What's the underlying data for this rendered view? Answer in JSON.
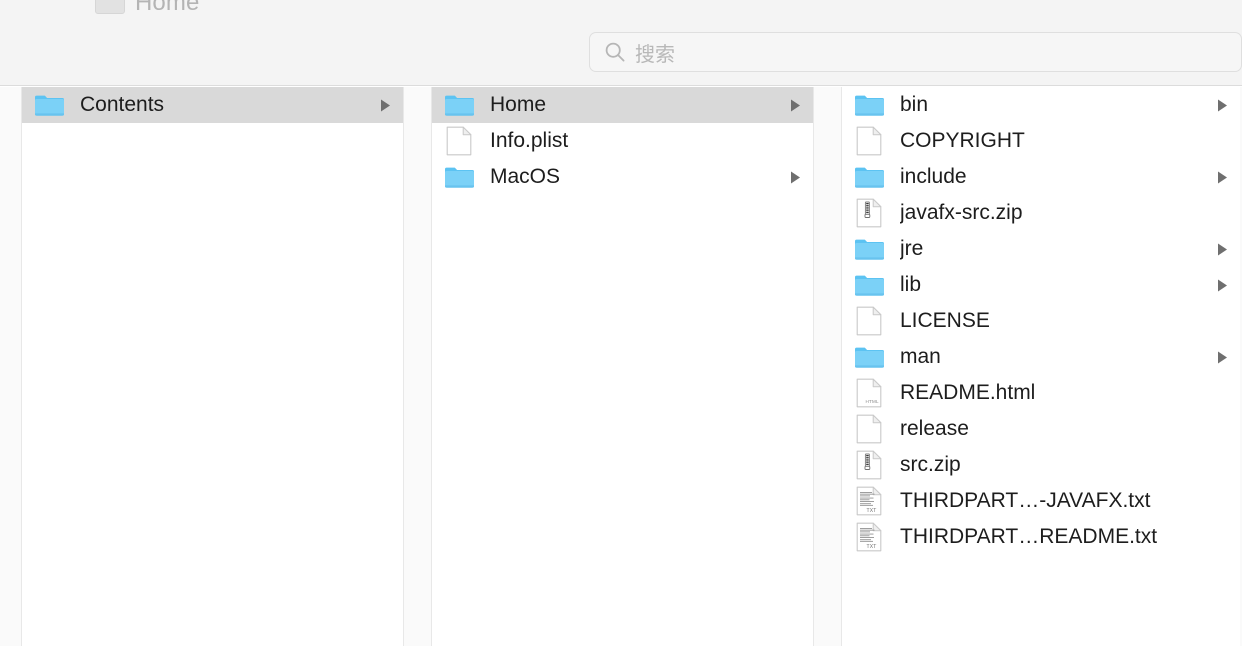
{
  "header": {
    "breadcrumb_label": "Home",
    "breadcrumb_icon": "generic-item-icon"
  },
  "search": {
    "icon": "search-icon",
    "placeholder": "搜索",
    "value": ""
  },
  "columns": [
    {
      "name": "column-one",
      "items": [
        {
          "label": "Contents",
          "icon": "folder-icon",
          "has_chevron": true,
          "selected": true
        }
      ]
    },
    {
      "name": "column-two",
      "items": [
        {
          "label": "Home",
          "icon": "folder-icon",
          "has_chevron": true,
          "selected": true
        },
        {
          "label": "Info.plist",
          "icon": "document-icon",
          "has_chevron": false,
          "selected": false
        },
        {
          "label": "MacOS",
          "icon": "folder-icon",
          "has_chevron": true,
          "selected": false
        }
      ]
    },
    {
      "name": "column-three",
      "items": [
        {
          "label": "bin",
          "icon": "folder-icon",
          "has_chevron": true,
          "selected": false
        },
        {
          "label": "COPYRIGHT",
          "icon": "document-icon",
          "has_chevron": false,
          "selected": false
        },
        {
          "label": "include",
          "icon": "folder-icon",
          "has_chevron": true,
          "selected": false
        },
        {
          "label": "javafx-src.zip",
          "icon": "zip-icon",
          "has_chevron": false,
          "selected": false
        },
        {
          "label": "jre",
          "icon": "folder-icon",
          "has_chevron": true,
          "selected": false
        },
        {
          "label": "lib",
          "icon": "folder-icon",
          "has_chevron": true,
          "selected": false
        },
        {
          "label": "LICENSE",
          "icon": "document-icon",
          "has_chevron": false,
          "selected": false
        },
        {
          "label": "man",
          "icon": "folder-icon",
          "has_chevron": true,
          "selected": false
        },
        {
          "label": "README.html",
          "icon": "html-icon",
          "has_chevron": false,
          "selected": false
        },
        {
          "label": "release",
          "icon": "document-icon",
          "has_chevron": false,
          "selected": false
        },
        {
          "label": "src.zip",
          "icon": "zip-icon",
          "has_chevron": false,
          "selected": false
        },
        {
          "label": "THIRDPART…-JAVAFX.txt",
          "icon": "text-icon",
          "has_chevron": false,
          "selected": false
        },
        {
          "label": "THIRDPART…README.txt",
          "icon": "text-icon",
          "has_chevron": false,
          "selected": false
        }
      ]
    }
  ],
  "colors": {
    "folder": "#6ecbf5",
    "selection": "#d9d9d9",
    "toolbar_bg": "#f4f4f4",
    "text": "#1d1d1d",
    "muted_text": "#b4b4b4"
  }
}
